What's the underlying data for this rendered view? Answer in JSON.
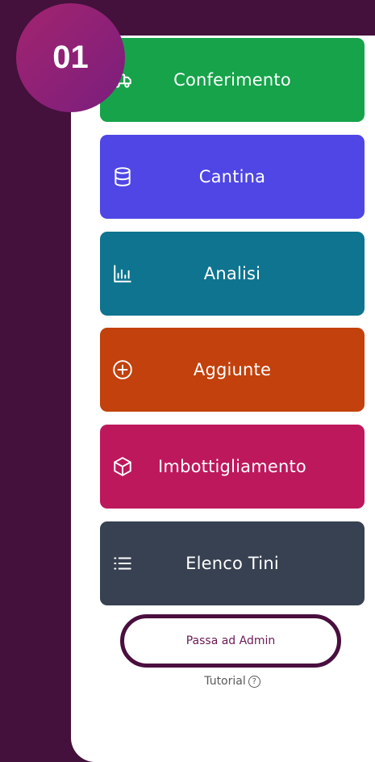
{
  "step_badge": "01",
  "colors": {
    "background": "#43113b",
    "conferimento": "#16a34a",
    "cantina": "#4f46e5",
    "analisi": "#0e7490",
    "aggiunte": "#c2410c",
    "imbottigliamento": "#be185d",
    "elenco_tini": "#374151",
    "admin_border": "#4a0f3e"
  },
  "menu": [
    {
      "label": "Conferimento",
      "icon": "truck-icon"
    },
    {
      "label": "Cantina",
      "icon": "database-icon"
    },
    {
      "label": "Analisi",
      "icon": "bar-chart-icon"
    },
    {
      "label": "Aggiunte",
      "icon": "plus-circle-icon"
    },
    {
      "label": "Imbottigliamento",
      "icon": "box-icon"
    },
    {
      "label": "Elenco Tini",
      "icon": "list-icon"
    }
  ],
  "admin_button": "Passa ad Admin",
  "tutorial": "Tutorial"
}
